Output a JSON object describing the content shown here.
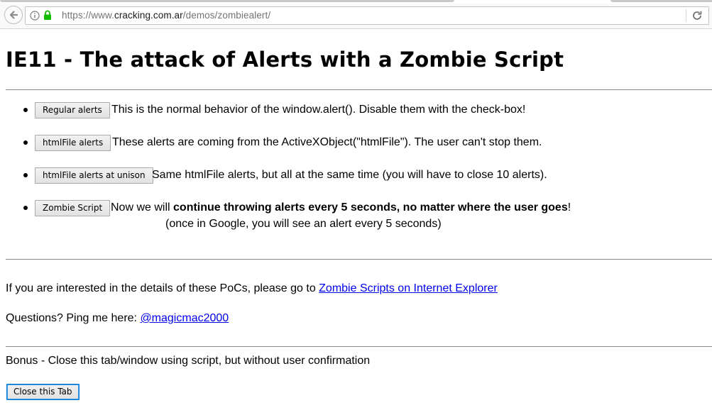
{
  "browser": {
    "url": {
      "scheme": "https://www.",
      "host": "cracking.com.ar",
      "path": "/demos/zombiealert/"
    }
  },
  "page": {
    "title": "IE11 - The attack of Alerts with a Zombie Script",
    "demos": [
      {
        "button": "Regular alerts",
        "text": "This is the normal behavior of the window.alert(). Disable them with the check-box!"
      },
      {
        "button": "htmlFile alerts",
        "text": "These alerts are coming from the ActiveXObject(\"htmlFile\"). The user can't stop them."
      },
      {
        "button": "htmlFile alerts at unison",
        "text": "Same htmlFile alerts, but all at the same time (you will have to close 10 alerts)."
      },
      {
        "button": "Zombie Script",
        "text_before": "Now we will ",
        "text_bold": "continue throwing alerts every 5 seconds, no matter where the user goes",
        "text_after": "!",
        "note": "(once in Google, you will see an alert every 5 seconds)"
      }
    ],
    "details": {
      "text": "If you are interested in the details of these PoCs, please go to ",
      "link": "Zombie Scripts on Internet Explorer"
    },
    "questions": {
      "text": "Questions? Ping me here: ",
      "link": "@magicmac2000"
    },
    "bonus": {
      "text": "Bonus - Close this tab/window using script, but without user confirmation",
      "button": "Close this Tab"
    }
  }
}
